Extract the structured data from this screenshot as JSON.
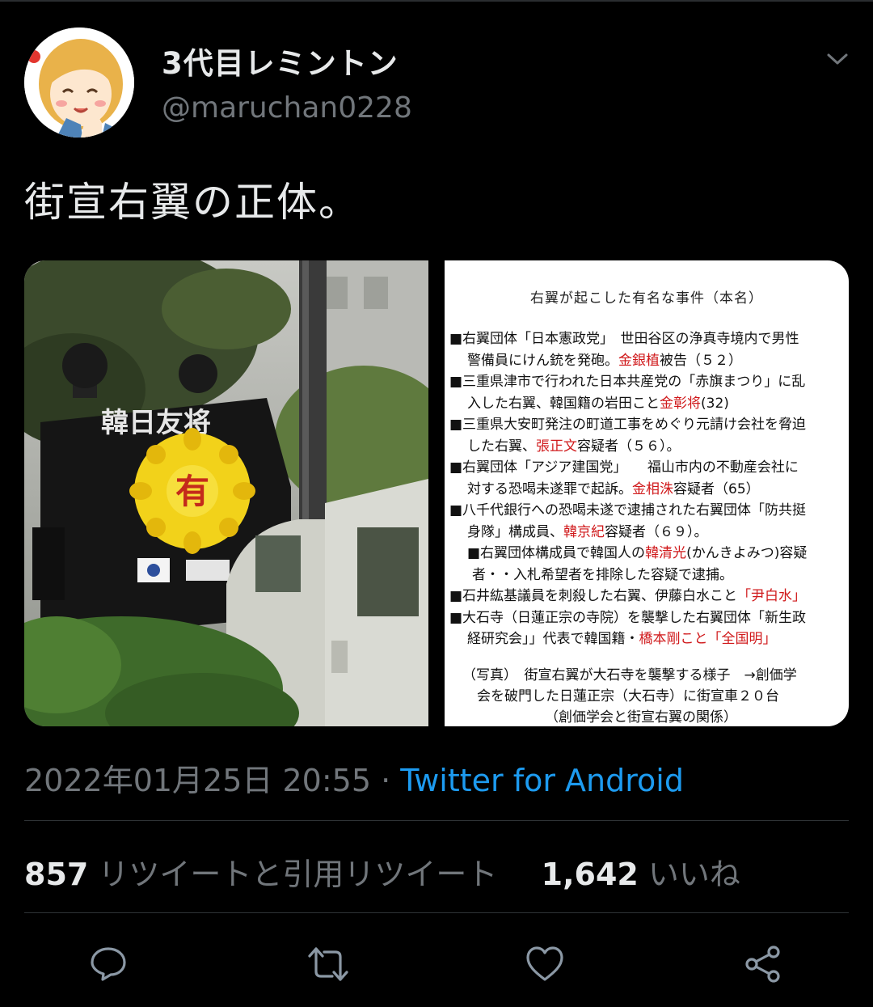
{
  "author": {
    "display_name": "3代目レミントン",
    "handle": "@maruchan0228",
    "avatar_icon": "avatar-illustration"
  },
  "tweet": {
    "text": "街宣右翼の正体。",
    "timestamp": "2022年01月25日 20:55",
    "separator": " · ",
    "source": "Twitter for Android"
  },
  "media": {
    "photo": {
      "truck_sign": "韓日友将",
      "chrysanthemum_char": "有"
    },
    "card": {
      "title": "右翼が起こした有名な事件（本名）",
      "lines": [
        {
          "pre": "■右翼団体「日本憲政党」　世田谷区の浄真寺境内で男性",
          "red": "",
          "post": "",
          "indent": ""
        },
        {
          "pre": "警備員にけん銃を発砲。",
          "red": "金銀植",
          "post": "被告（５２）",
          "indent": "indent"
        },
        {
          "pre": "■三重県津市で行われた日本共産党の「赤旗まつり」に乱",
          "red": "",
          "post": "",
          "indent": ""
        },
        {
          "pre": "入した右翼、韓国籍の岩田こと",
          "red": "金彰将",
          "post": "(32)",
          "indent": "indent"
        },
        {
          "pre": "■三重県大安町発注の町道工事をめぐり元請け会社を脅迫",
          "red": "",
          "post": "",
          "indent": ""
        },
        {
          "pre": "した右翼、",
          "red": "張正文",
          "post": "容疑者（５６）。",
          "indent": "indent"
        },
        {
          "pre": "■右翼団体「アジア建国党」　　福山市内の不動産会社に",
          "red": "",
          "post": "",
          "indent": ""
        },
        {
          "pre": "対する恐喝未遂罪で起訴。",
          "red": "金相洙",
          "post": "容疑者（65）",
          "indent": "indent"
        },
        {
          "pre": "■八千代銀行への恐喝未遂で逮捕された右翼団体「防共挺",
          "red": "",
          "post": "",
          "indent": ""
        },
        {
          "pre": "身隊」構成員、",
          "red": "韓京紀",
          "post": "容疑者（６９）。",
          "indent": "indent"
        },
        {
          "pre": "■右翼団体構成員で韓国人の",
          "red": "韓清光",
          "post": "(かんきよみつ)容疑",
          "indent": "indent"
        },
        {
          "pre": "者・・入札希望者を排除した容疑で逮捕。",
          "red": "",
          "post": "",
          "indent": "indent2"
        },
        {
          "pre": "■石井紘基議員を刺殺した右翼、伊藤白水こと",
          "red": "「尹白水」",
          "post": "",
          "indent": ""
        },
        {
          "pre": "■大石寺（日蓮正宗の寺院）を襲撃した右翼団体「新生政",
          "red": "",
          "post": "",
          "indent": ""
        },
        {
          "pre": "経研究会」」代表で韓国籍・",
          "red": "橋本剛こと「全国明」",
          "post": "",
          "indent": "indent"
        }
      ],
      "note_1": "（写真）　街宣右翼が大石寺を襲撃する様子　→創価学",
      "note_2": "会を破門した日蓮正宗（大石寺）に街宣車２０台",
      "note_3": "（創価学会と街宣右翼の関係）"
    }
  },
  "stats": {
    "retweets_count": "857",
    "retweets_label": "リツイートと引用リツイート",
    "likes_count": "1,642",
    "likes_label": "いいね"
  },
  "actions": {
    "reply_icon": "reply-icon",
    "retweet_icon": "retweet-icon",
    "like_icon": "heart-icon",
    "share_icon": "share-icon"
  },
  "colors": {
    "background": "#000000",
    "text": "#e7e9ea",
    "secondary": "#71767b",
    "link": "#1d9bf0",
    "highlight_red": "#d0191b"
  }
}
